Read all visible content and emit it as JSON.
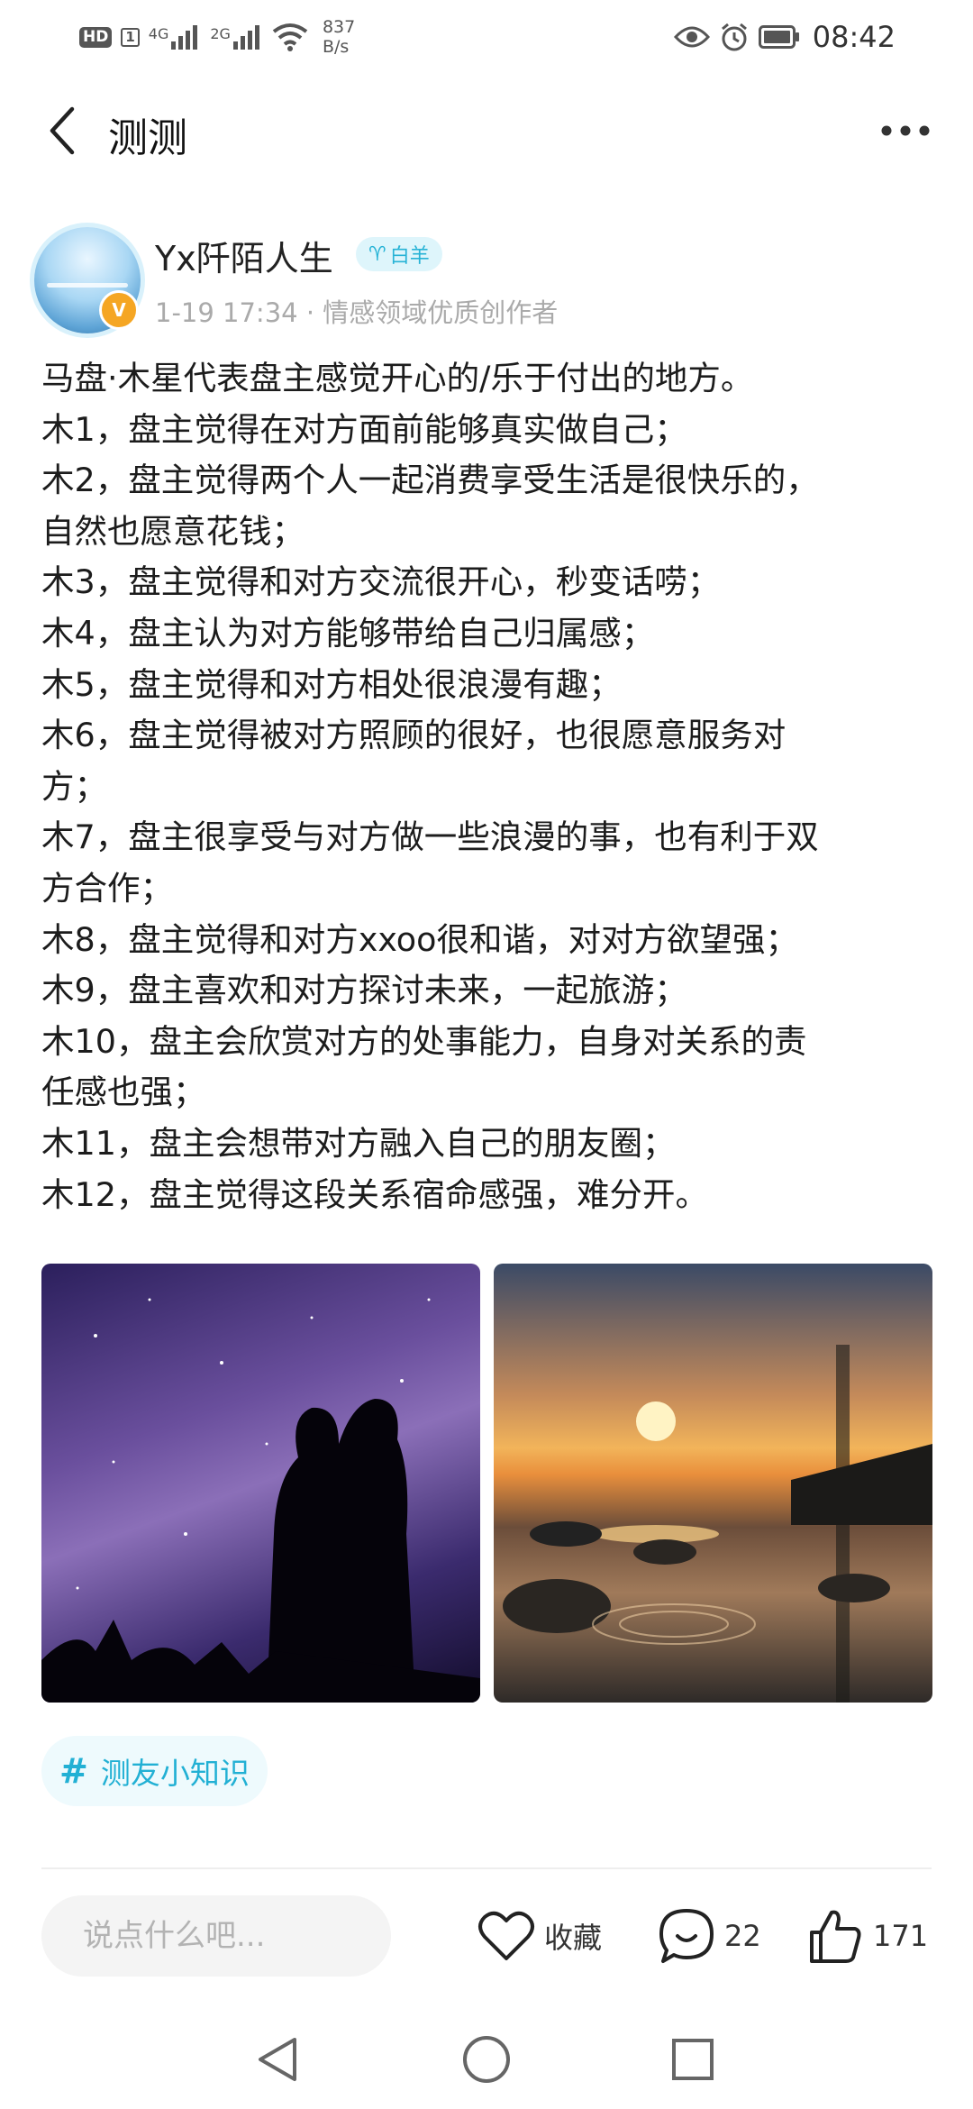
{
  "status_bar": {
    "hd": "HD",
    "sim": "1",
    "net1": "4G",
    "net2": "2G",
    "speed_value": "837",
    "speed_unit": "B/s",
    "time": "08:42"
  },
  "header": {
    "title": "测测"
  },
  "author": {
    "name": "Yx阡陌人生",
    "zodiac_symbol": "♈",
    "zodiac": "白羊",
    "verified_mark": "V",
    "meta": "1-19 17:34 · 情感领域优质创作者"
  },
  "post": {
    "lines": [
      "马盘·木星代表盘主感觉开心的/乐于付出的地方。",
      "木1，盘主觉得在对方面前能够真实做自己；",
      "木2，盘主觉得两个人一起消费享受生活是很快乐的，",
      "自然也愿意花钱；",
      "木3，盘主觉得和对方交流很开心，秒变话唠；",
      "木4，盘主认为对方能够带给自己归属感；",
      "木5，盘主觉得和对方相处很浪漫有趣；",
      "木6，盘主觉得被对方照顾的很好，也很愿意服务对",
      "方；",
      "木7，盘主很享受与对方做一些浪漫的事，也有利于双",
      "方合作；",
      "木8，盘主觉得和对方xxoo很和谐，对对方欲望强；",
      "木9，盘主喜欢和对方探讨未来，一起旅游；",
      "木10，盘主会欣赏对方的处事能力，自身对关系的责",
      "任感也强；",
      "木11，盘主会想带对方融入自己的朋友圈；",
      "木12，盘主觉得这段关系宿命感强，难分开。"
    ],
    "topic_hash": "#",
    "topic": "测友小知识"
  },
  "actions": {
    "comment_placeholder": "说点什么吧...",
    "favorite_label": "收藏",
    "comment_count": "22",
    "like_count": "171"
  },
  "icons": {
    "back": "chevron-left-icon",
    "more": "more-dots-icon",
    "favorite": "heart-icon",
    "comment": "comment-bubble-icon",
    "like": "thumbs-up-icon",
    "nav_back": "triangle-back-icon",
    "nav_home": "circle-home-icon",
    "nav_recent": "square-recent-icon"
  },
  "colors": {
    "accent": "#27b3d6",
    "tag_bg": "#def5fb",
    "badge": "#f5a623"
  }
}
